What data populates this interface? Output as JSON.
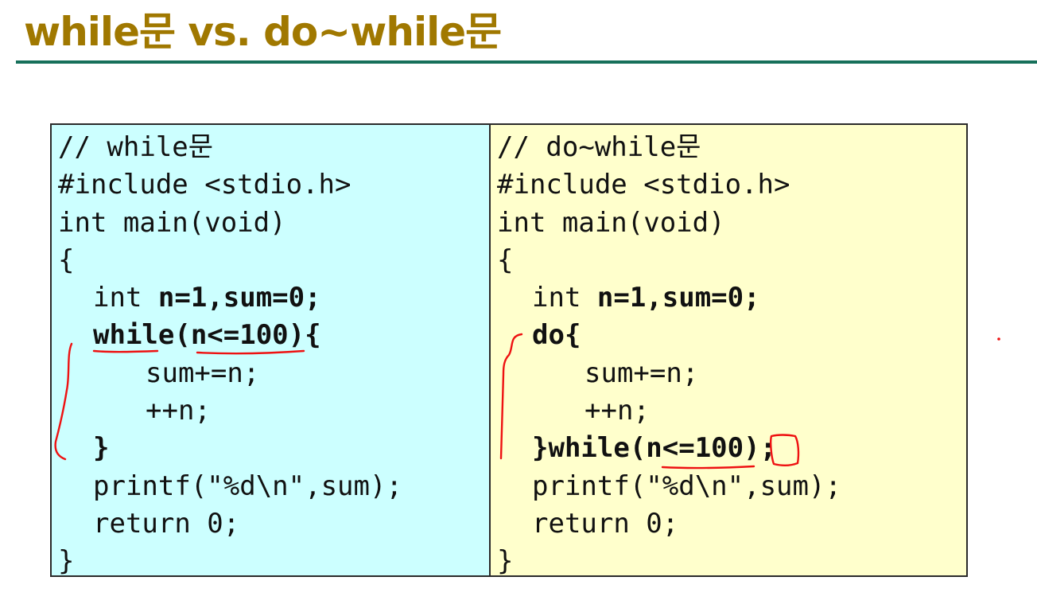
{
  "slide": {
    "title": "while문 vs. do~while문"
  },
  "while_example": {
    "lines": [
      {
        "text": "// while문",
        "indent": 0,
        "bold": false
      },
      {
        "text": "#include <stdio.h>",
        "indent": 0,
        "bold": false
      },
      {
        "text": "int main(void)",
        "indent": 0,
        "bold": false
      },
      {
        "text": "{",
        "indent": 0,
        "bold": false
      },
      {
        "segments": [
          {
            "text": "int ",
            "bold": false
          },
          {
            "text": "n=1,sum=0;",
            "bold": true
          }
        ],
        "indent": 1
      },
      {
        "text": "while(n<=100){",
        "indent": 1,
        "bold": true
      },
      {
        "text": "sum+=n;",
        "indent": 2,
        "bold": false
      },
      {
        "text": "++n;",
        "indent": 2,
        "bold": false
      },
      {
        "text": "}",
        "indent": 1,
        "bold": true
      },
      {
        "text": "printf(\"%d\\n\",sum);",
        "indent": 1,
        "bold": false
      },
      {
        "text": "return 0;",
        "indent": 1,
        "bold": false
      },
      {
        "text": "}",
        "indent": 0,
        "bold": false
      }
    ]
  },
  "do_while_example": {
    "lines": [
      {
        "text": "// do~while문",
        "indent": 0,
        "bold": false
      },
      {
        "text": "#include <stdio.h>",
        "indent": 0,
        "bold": false
      },
      {
        "text": "int main(void)",
        "indent": 0,
        "bold": false
      },
      {
        "text": "{",
        "indent": 0,
        "bold": false
      },
      {
        "segments": [
          {
            "text": "int ",
            "bold": false
          },
          {
            "text": "n=1,sum=0;",
            "bold": true
          }
        ],
        "indent": 1
      },
      {
        "text": "do{",
        "indent": 1,
        "bold": true
      },
      {
        "text": "sum+=n;",
        "indent": 2,
        "bold": false
      },
      {
        "text": "++n;",
        "indent": 2,
        "bold": false
      },
      {
        "text": "}while(n<=100);",
        "indent": 1,
        "bold": true
      },
      {
        "text": "printf(\"%d\\n\",sum);",
        "indent": 1,
        "bold": false
      },
      {
        "text": "return 0;",
        "indent": 1,
        "bold": false
      },
      {
        "text": "}",
        "indent": 0,
        "bold": false
      }
    ]
  },
  "colors": {
    "title": "#a07800",
    "rule": "#16705a",
    "while_bg": "#ccffff",
    "do_while_bg": "#ffffcc",
    "annotation_ink": "#ee1111"
  }
}
